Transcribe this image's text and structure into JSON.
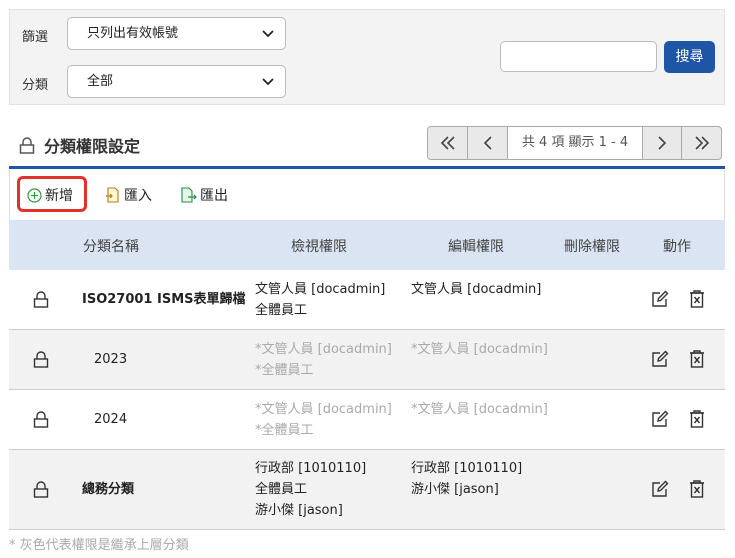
{
  "filter": {
    "filter_label": "篩選",
    "filter_value": "只列出有效帳號",
    "category_label": "分類",
    "category_value": "全部",
    "search_placeholder": "",
    "search_button": "搜尋"
  },
  "panel": {
    "title": "分類權限設定",
    "pagination_info": "共 4 項 顯示 1 - 4"
  },
  "toolbar": {
    "add": "新增",
    "import": "匯入",
    "export": "匯出"
  },
  "table": {
    "headers": [
      "分類名稱",
      "檢視權限",
      "編輯權限",
      "刪除權限",
      "動作"
    ],
    "rows": [
      {
        "name": "ISO27001 ISMS表單歸檔",
        "view": [
          "文管人員 [docadmin]",
          "全體員工"
        ],
        "edit": [
          "文管人員 [docadmin]"
        ],
        "inherited": false
      },
      {
        "name": "2023",
        "view": [
          "*文管人員 [docadmin]",
          "*全體員工"
        ],
        "edit": [
          "*文管人員 [docadmin]"
        ],
        "inherited": true
      },
      {
        "name": "2024",
        "view": [
          "*文管人員 [docadmin]",
          "*全體員工"
        ],
        "edit": [
          "*文管人員 [docadmin]"
        ],
        "inherited": true
      },
      {
        "name": "總務分類",
        "view": [
          "行政部 [1010110]",
          "全體員工",
          "游小傑 [jason]"
        ],
        "edit": [
          "行政部 [1010110]",
          "游小傑 [jason]"
        ],
        "inherited": false
      }
    ]
  },
  "footnote": "* 灰色代表權限是繼承上層分類",
  "colors": {
    "accent": "#1f55a5",
    "header_bg": "#dbe4f2",
    "highlight": "#e0312b",
    "inherited_text": "#aaaaaa"
  }
}
